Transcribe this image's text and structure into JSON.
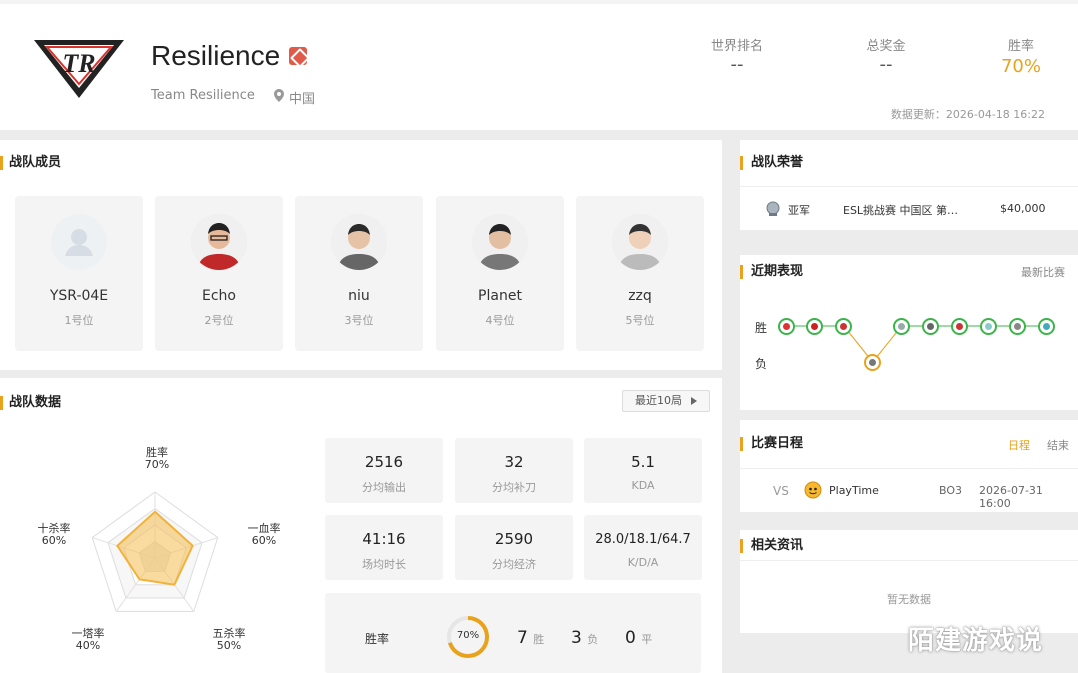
{
  "header": {
    "team_name": "Resilience",
    "full_name": "Team Resilience",
    "region": "中国",
    "stats": [
      {
        "label": "世界排名",
        "value": "--"
      },
      {
        "label": "总奖金",
        "value": "--"
      },
      {
        "label": "胜率",
        "value": "70%"
      }
    ],
    "updated": "数据更新：2026-04-18 16:22",
    "accent": "#e8a21c"
  },
  "members": {
    "title": "战队成员",
    "items": [
      {
        "name": "YSR-04E",
        "pos": "1号位"
      },
      {
        "name": "Echo",
        "pos": "2号位"
      },
      {
        "name": "niu",
        "pos": "3号位"
      },
      {
        "name": "Planet",
        "pos": "4号位"
      },
      {
        "name": "zzq",
        "pos": "5号位"
      }
    ]
  },
  "team_data": {
    "title": "战队数据",
    "filter": "最近10局",
    "radar": [
      {
        "label": "胜率",
        "value": "70%",
        "v": 70
      },
      {
        "label": "一血率",
        "value": "60%",
        "v": 60
      },
      {
        "label": "五杀率",
        "value": "50%",
        "v": 50
      },
      {
        "label": "一塔率",
        "value": "40%",
        "v": 40
      },
      {
        "label": "十杀率",
        "value": "60%",
        "v": 60
      }
    ],
    "tiles": [
      {
        "value": "2516",
        "label": "分均输出"
      },
      {
        "value": "32",
        "label": "分均补刀"
      },
      {
        "value": "5.1",
        "label": "KDA"
      },
      {
        "value": "41:16",
        "label": "场均时长"
      },
      {
        "value": "2590",
        "label": "分均经济"
      },
      {
        "value": "28.0/18.1/64.7",
        "label": "K/D/A"
      }
    ],
    "winrate": {
      "label": "胜率",
      "percent": "70%",
      "fraction": 0.7,
      "wins": "7",
      "wins_unit": "胜",
      "losses": "3",
      "losses_unit": "负",
      "draws": "0",
      "draws_unit": "平"
    }
  },
  "honors": {
    "title": "战队荣誉",
    "items": [
      {
        "rank": "亚军",
        "event": "ESL挑战赛 中国区 第…",
        "prize": "$40,000"
      }
    ]
  },
  "recent": {
    "title": "近期表现",
    "link": "最新比赛",
    "win_label": "胜",
    "loss_label": "负",
    "results": [
      "W",
      "W",
      "W",
      "L",
      "W",
      "W",
      "W",
      "W",
      "W",
      "W"
    ]
  },
  "schedule": {
    "title": "比赛日程",
    "tab_schedule": "日程",
    "tab_finished": "结束",
    "items": [
      {
        "vs": "VS",
        "opponent": "PlayTime",
        "format": "BO3",
        "time": "2026-07-31 16:00"
      }
    ]
  },
  "news": {
    "title": "相关资讯",
    "empty": "暂无数据"
  },
  "watermark": "陌建游戏说"
}
